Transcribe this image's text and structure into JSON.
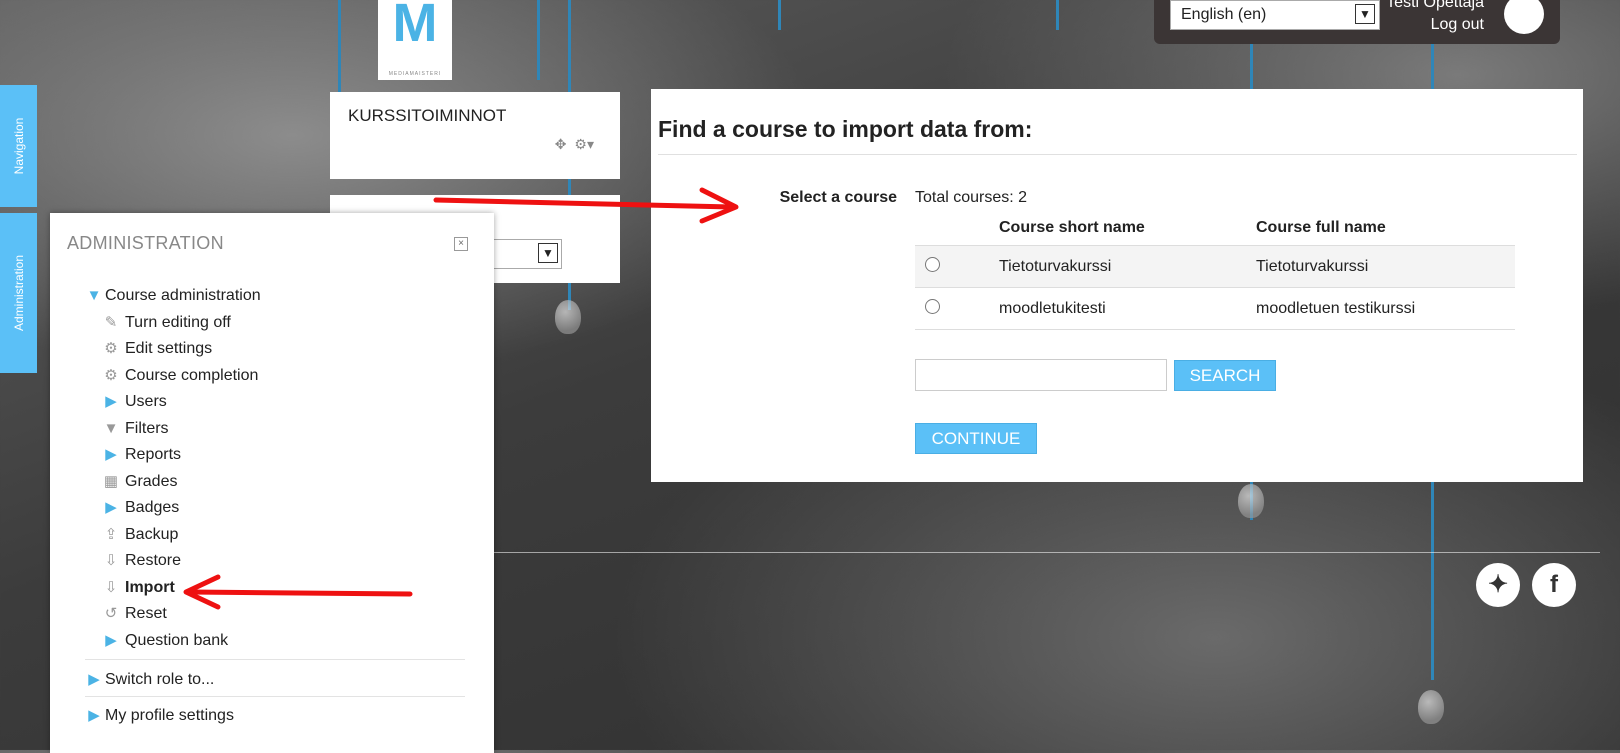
{
  "header": {
    "logo_text": "M",
    "logo_subtext": "MEDIAMAISTERI",
    "language": "English (en)",
    "user_name": "Testi Opettaja",
    "logout": "Log out"
  },
  "side_tabs": {
    "navigation": "Navigation",
    "administration": "Administration"
  },
  "kurssitoiminnot": {
    "title": "KURSSITOIMINNOT"
  },
  "admin": {
    "title": "ADMINISTRATION",
    "course_admin": "Course administration",
    "items": [
      {
        "label": "Turn editing off",
        "icon": "pencil-icon"
      },
      {
        "label": "Edit settings",
        "icon": "gear-icon"
      },
      {
        "label": "Course completion",
        "icon": "gear-icon"
      },
      {
        "label": "Users",
        "icon": "caret-right-icon"
      },
      {
        "label": "Filters",
        "icon": "filter-icon"
      },
      {
        "label": "Reports",
        "icon": "caret-right-icon"
      },
      {
        "label": "Grades",
        "icon": "table-icon"
      },
      {
        "label": "Badges",
        "icon": "caret-right-icon"
      },
      {
        "label": "Backup",
        "icon": "upload-icon"
      },
      {
        "label": "Restore",
        "icon": "download-icon"
      },
      {
        "label": "Import",
        "icon": "download-icon"
      },
      {
        "label": "Reset",
        "icon": "reset-icon"
      },
      {
        "label": "Question bank",
        "icon": "caret-right-icon"
      }
    ],
    "switch_role": "Switch role to...",
    "profile_settings": "My profile settings"
  },
  "main": {
    "title": "Find a course to import data from:",
    "select_label": "Select a course",
    "total": "Total courses: 2",
    "headers": {
      "short": "Course short name",
      "full": "Course full name"
    },
    "courses": [
      {
        "short": "Tietoturvakurssi",
        "full": "Tietoturvakurssi"
      },
      {
        "short": "moodletukitesti",
        "full": "moodletuen testikurssi"
      }
    ],
    "search_button": "SEARCH",
    "continue_button": "CONTINUE"
  },
  "social": {
    "twitter": "twitter-icon",
    "facebook": "facebook-icon"
  },
  "colors": {
    "accent": "#5bc0f7",
    "arrow": "#ee1111"
  }
}
